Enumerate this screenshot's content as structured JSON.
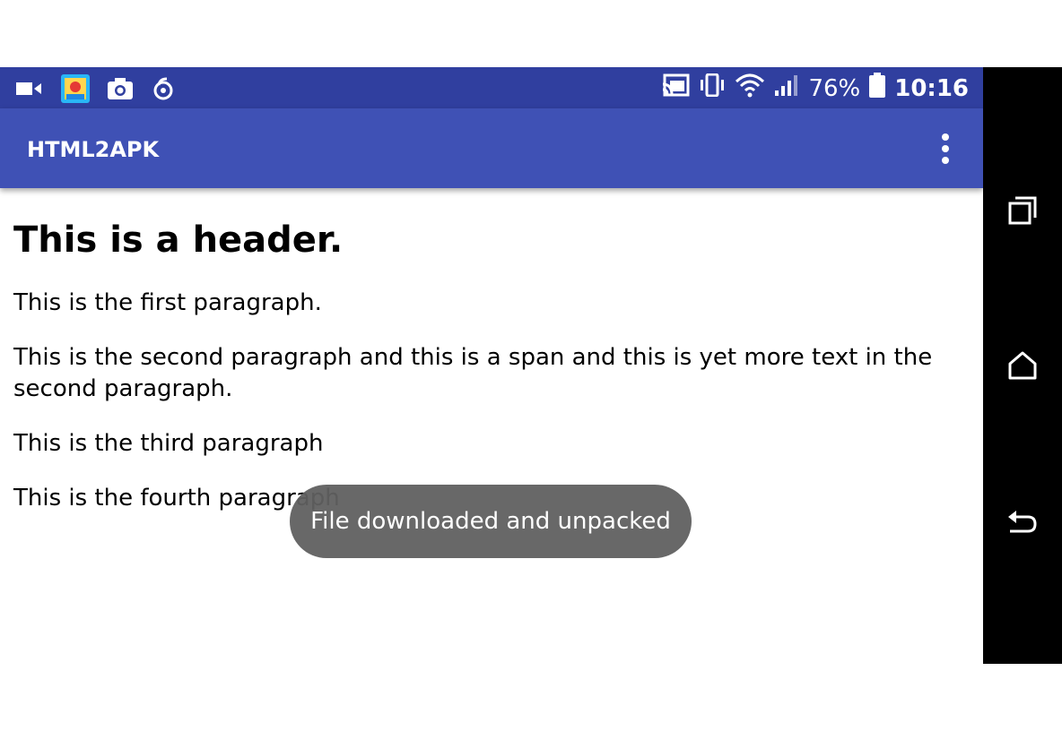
{
  "status_bar": {
    "battery": "76%",
    "time": "10:16",
    "left_icons": [
      "video-camera-icon",
      "gallery-app-icon",
      "camera-icon",
      "netease-music-icon"
    ],
    "right_icons": [
      "cast-icon",
      "vibrate-icon",
      "wifi-icon",
      "signal-icon",
      "battery-icon"
    ]
  },
  "app_bar": {
    "title": "HTML2APK"
  },
  "content": {
    "header": "This is a header.",
    "p1": "This is the first paragraph.",
    "p2": "This is the second paragraph and this is a span and this is yet more text in the second paragraph.",
    "p3": "This is the third paragraph",
    "p4": "This is the fourth paragraph"
  },
  "toast": {
    "message": "File downloaded and unpacked"
  },
  "nav_bar": {
    "buttons": [
      "recents-icon",
      "home-icon",
      "back-icon"
    ]
  },
  "colors": {
    "status_bar": "#303f9f",
    "app_bar": "#3f51b5",
    "toast_bg": "#606060"
  }
}
